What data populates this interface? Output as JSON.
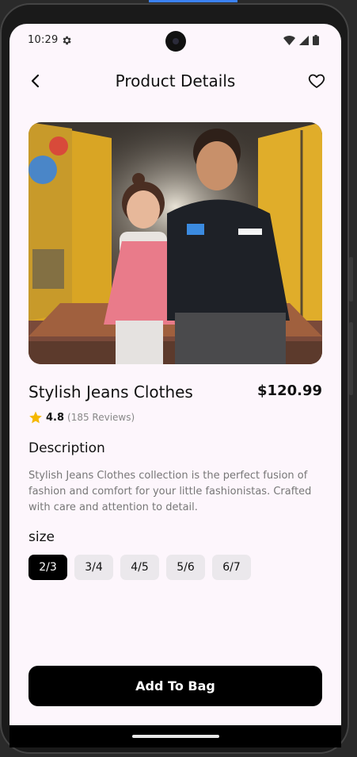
{
  "status_bar": {
    "time": "10:29",
    "icons": [
      "gear-icon",
      "wifi-icon",
      "signal-icon",
      "battery-icon"
    ]
  },
  "header": {
    "title": "Product Details",
    "back_icon": "chevron-left-icon",
    "favorite_icon": "heart-outline-icon"
  },
  "hero": {
    "alt": "Two children sitting together, a girl in a pink gingham outfit and a boy in a black hoodie"
  },
  "product": {
    "name": "Stylish Jeans Clothes",
    "price": "$120.99",
    "rating": "4.8",
    "reviews": "(185 Reviews)"
  },
  "description": {
    "title": "Description",
    "text": "Stylish Jeans Clothes collection is the perfect fusion of fashion and comfort for your little fashionistas. Crafted with care and attention to detail."
  },
  "size": {
    "title": "size",
    "options": [
      "2/3",
      "3/4",
      "4/5",
      "5/6",
      "6/7"
    ],
    "selected": "2/3"
  },
  "cta": {
    "label": "Add To Bag"
  },
  "colors": {
    "accent": "#000000",
    "background": "#fdf6fc",
    "chip": "#ebe8ec",
    "star": "#f5b800"
  }
}
